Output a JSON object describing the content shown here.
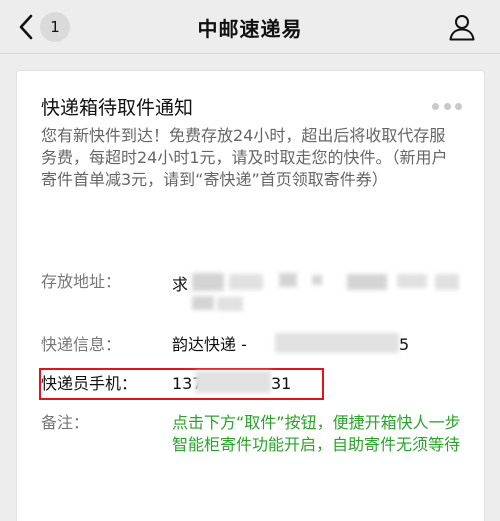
{
  "nav": {
    "back_badge": "1",
    "title": "中邮速递易",
    "back_icon": "chevron-left",
    "user_icon": "person-outline"
  },
  "card": {
    "title": "快递箱待取件通知",
    "intro": "您有新快件到达！免费存放24小时，超出后将收取代存服务费，每超时24小时1元，请及时取走您的快件。（新用户寄件首单减3元，请到“寄快递”首页领取寄件券）",
    "address": {
      "label": "存放地址：",
      "value_visible": "求"
    },
    "courier_info": {
      "label": "快递信息：",
      "value_prefix": "韵达快递 -",
      "value_suffix": "5"
    },
    "courier_phone": {
      "label": "快递员手机：",
      "value_prefix": "137",
      "value_suffix": "31"
    },
    "remark": {
      "label": "备注：",
      "line1": "点击下方“取件”按钮，便捷开箱快人一步",
      "line2": "智能柜寄件功能开启，自助寄件无须等待"
    }
  },
  "colors": {
    "background": "#ededed",
    "card": "#ffffff",
    "remark_green": "#2aa32a",
    "highlight_red": "#e0141c",
    "label_gray": "#777777"
  }
}
